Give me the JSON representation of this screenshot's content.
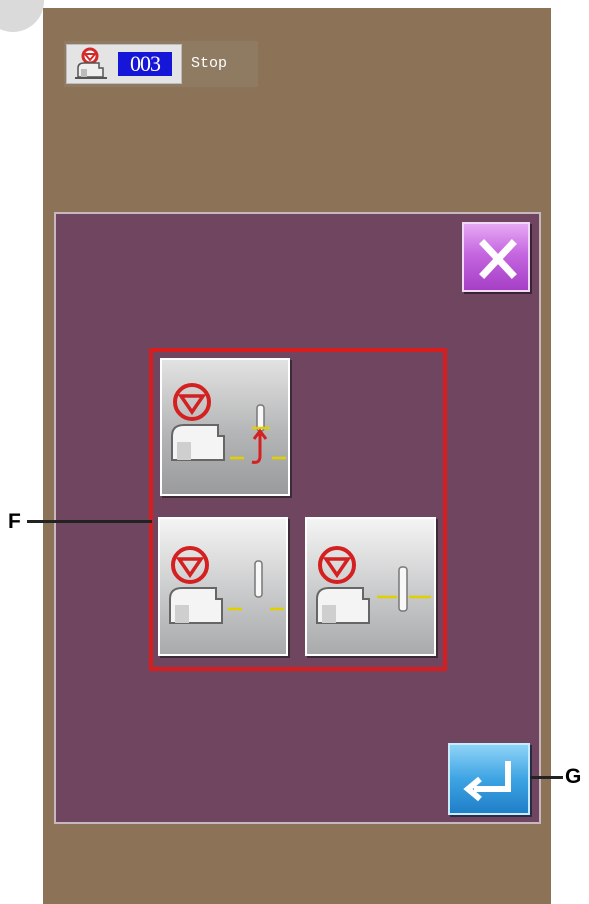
{
  "status": {
    "icon": "sewing-machine-stop-icon",
    "number": "003",
    "text": "Stop"
  },
  "dialog": {
    "close_icon": "close-icon",
    "enter_icon": "enter-icon",
    "options": [
      {
        "icon": "needle-position-reverse-icon",
        "selected": true
      },
      {
        "icon": "needle-stop-down-icon",
        "selected": false
      },
      {
        "icon": "needle-stop-up-icon",
        "selected": false
      }
    ]
  },
  "callouts": {
    "f": "F",
    "g": "G"
  },
  "colors": {
    "screen_bg": "#8c7358",
    "dialog_bg": "#704560",
    "frame_red": "#d71d1d",
    "close_purple": "#c567e0",
    "enter_blue": "#3ea4e3",
    "number_blue": "#1616d8"
  }
}
